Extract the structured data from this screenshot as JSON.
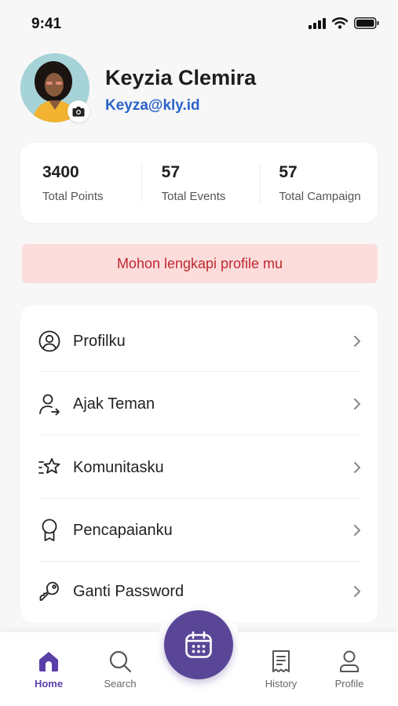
{
  "status_bar": {
    "time": "9:41"
  },
  "profile": {
    "name": "Keyzia Clemira",
    "email": "Keyza@kly.id"
  },
  "stats": [
    {
      "value": "3400",
      "label": "Total Points"
    },
    {
      "value": "57",
      "label": "Total Events"
    },
    {
      "value": "57",
      "label": "Total Campaign"
    }
  ],
  "alert": {
    "text": "Mohon lengkapi profile mu"
  },
  "menu": [
    {
      "label": "Profilku",
      "icon": "user-circle-icon"
    },
    {
      "label": "Ajak Teman",
      "icon": "user-share-icon"
    },
    {
      "label": "Komunitasku",
      "icon": "star-list-icon"
    },
    {
      "label": "Pencapaianku",
      "icon": "award-icon"
    },
    {
      "label": "Ganti Password",
      "icon": "key-icon"
    }
  ],
  "bottom_nav": {
    "home": "Home",
    "search": "Search",
    "history": "History",
    "profile": "Profile"
  },
  "colors": {
    "accent": "#5a4697",
    "email": "#2b63c9",
    "alert_bg": "#fddcdc",
    "alert_text": "#c0282e"
  }
}
